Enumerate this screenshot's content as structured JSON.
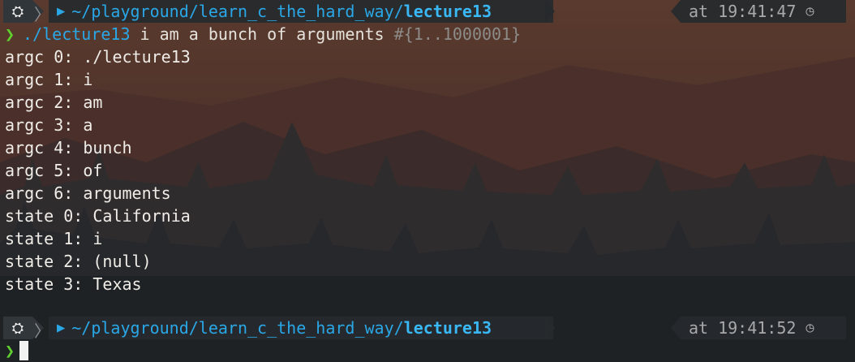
{
  "prompt_top": {
    "path_prefix": "~/playground/learn_c_the_hard_way/",
    "path_last": "lecture13",
    "at_label": "at",
    "time": "19:41:47"
  },
  "command": {
    "prompt_symbol": "❯",
    "executable": "./lecture13",
    "args": " i am a bunch of arguments ",
    "range": "#{1..1000001}"
  },
  "output_lines": [
    "argc 0: ./lecture13",
    "argc 1: i",
    "argc 2: am",
    "argc 3: a",
    "argc 4: bunch",
    "argc 5: of",
    "argc 6: arguments",
    "state 0: California",
    "state 1: i",
    "state 2: (null)",
    "state 3: Texas"
  ],
  "prompt_bottom": {
    "path_prefix": "~/playground/learn_c_the_hard_way/",
    "path_last": "lecture13",
    "at_label": "at",
    "time": "19:41:52"
  },
  "input_prompt_symbol": "❯",
  "icons": {
    "os": "ubuntu-icon",
    "folder": "folder-icon",
    "clock": "clock-icon"
  },
  "colors": {
    "path_blue": "#2aa7e6",
    "prompt_green": "#5fd02e",
    "segment_bg": "#262a2e"
  }
}
